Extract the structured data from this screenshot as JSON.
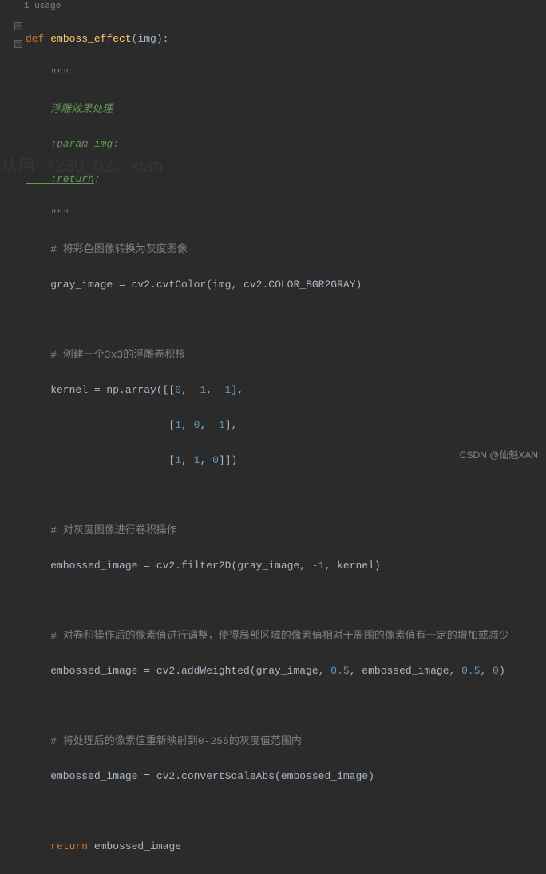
{
  "usage": "1 usage",
  "code": {
    "def": "def ",
    "fn_name": "emboss_effect",
    "params": "(img):",
    "docq": "    \"\"\"",
    "doc1": "    浮雕效果处理",
    "doc_param": "    :param",
    "doc_param_rest": " img:",
    "doc_return": "    :return",
    "doc_return_rest": ":",
    "cmt1": "    # 将彩色图像转换为灰度图像",
    "l_gray": "    gray_image = cv2.cvtColor(img",
    "l_gray2": " cv2.COLOR_BGR2GRAY)",
    "cmt2": "    # 创建一个3x3的浮雕卷积核",
    "k1a": "    kernel = np.array([[",
    "k1b": "0",
    "k1c": ", ",
    "k1d": "-1",
    "k1e": ", ",
    "k1f": "-1",
    "k1g": "],",
    "k2a": "                       [",
    "k2b": "1",
    "k2c": ", ",
    "k2d": "0",
    "k2e": ", ",
    "k2f": "-1",
    "k2g": "],",
    "k3a": "                       [",
    "k3b": "1",
    "k3c": ", ",
    "k3d": "1",
    "k3e": ", ",
    "k3f": "0",
    "k3g": "]])",
    "cmt3": "    # 对灰度图像进行卷积操作",
    "f2a": "    embossed_image = cv2.filter2D(gray_image",
    "f2b": ", ",
    "f2c": "-1",
    "f2d": ", kernel)",
    "cmt4": "    # 对卷积操作后的像素值进行调整，使得局部区域的像素值相对于周围的像素值有一定的增加或减少",
    "aw_a": "    embossed_image = cv2.addWeighted(gray_image",
    "aw_b": ", ",
    "aw_c": "0.5",
    "aw_d": ", embossed_image",
    "aw_e": ", ",
    "aw_f": "0.5",
    "aw_g": ", ",
    "aw_h": "0",
    "aw_i": ")",
    "cmt5": "    # 将处理后的像素值重新映射到0-255的灰度值范围内",
    "cs_a": "    embossed_image = cv2.convertScaleAbs(embossed_image)",
    "ret": "    return ",
    "ret_v": "embossed_image"
  },
  "watermark": "CSDN @仙魁XAN",
  "bg_watermark": "从用:\n7230_02、xian"
}
